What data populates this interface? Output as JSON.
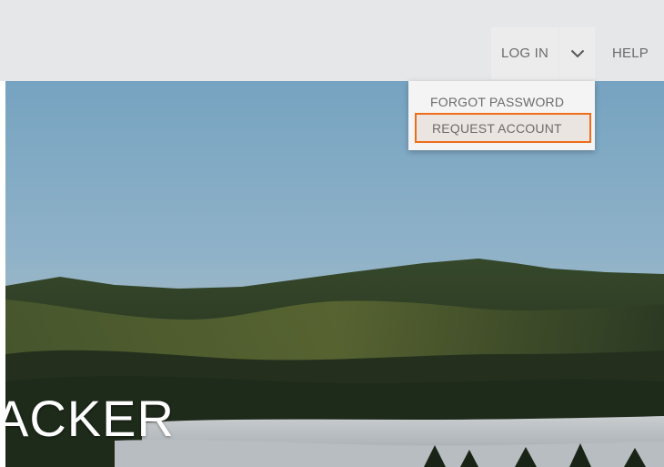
{
  "nav": {
    "login_label": "LOG IN",
    "help_label": "HELP"
  },
  "dropdown": {
    "items": [
      {
        "label": "FORGOT PASSWORD"
      },
      {
        "label": "REQUEST ACCOUNT"
      }
    ]
  },
  "hero": {
    "title": "ACKER"
  },
  "icons": {
    "caret": "chevron-down-icon"
  },
  "colors": {
    "navbar_bg": "#e6e7e8",
    "highlight_border": "#ef6c1a",
    "text": "#6b6b6b"
  }
}
